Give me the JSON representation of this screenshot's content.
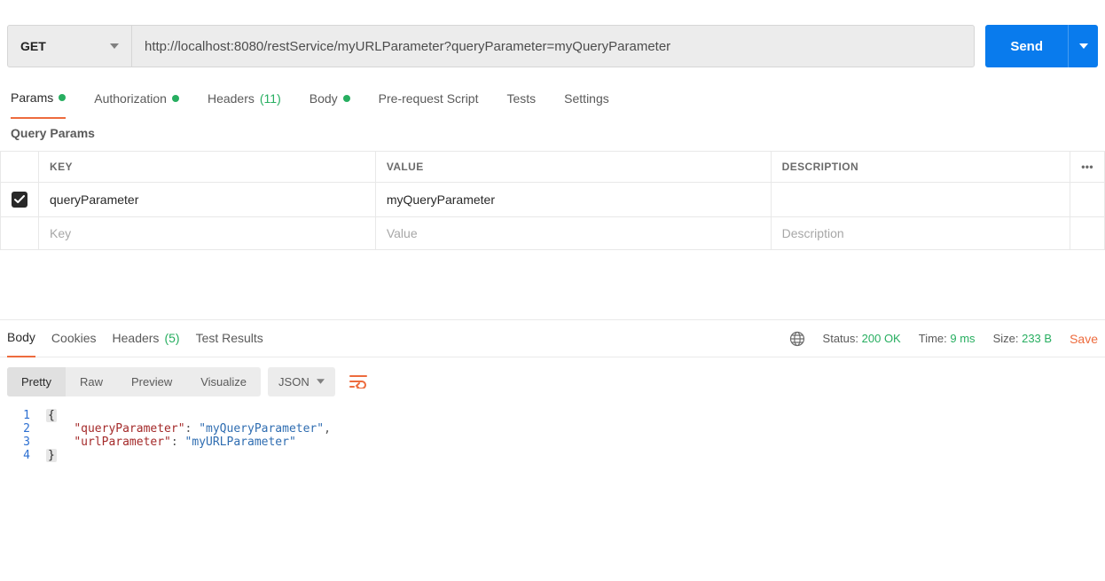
{
  "request": {
    "method": "GET",
    "url": "http://localhost:8080/restService/myURLParameter?queryParameter=myQueryParameter",
    "send_label": "Send"
  },
  "req_tabs": {
    "params": "Params",
    "authorization": "Authorization",
    "headers_label": "Headers",
    "headers_count": "(11)",
    "body": "Body",
    "prereq": "Pre-request Script",
    "tests": "Tests",
    "settings": "Settings"
  },
  "params": {
    "section_title": "Query Params",
    "col_key": "KEY",
    "col_value": "VALUE",
    "col_desc": "DESCRIPTION",
    "rows": [
      {
        "key": "queryParameter",
        "value": "myQueryParameter",
        "desc": ""
      }
    ],
    "placeholders": {
      "key": "Key",
      "value": "Value",
      "desc": "Description"
    }
  },
  "resp_tabs": {
    "body": "Body",
    "cookies": "Cookies",
    "headers_label": "Headers",
    "headers_count": "(5)",
    "test_results": "Test Results"
  },
  "resp_meta": {
    "status_label": "Status:",
    "status_value": "200 OK",
    "time_label": "Time:",
    "time_value": "9 ms",
    "size_label": "Size:",
    "size_value": "233 B",
    "save": "Save"
  },
  "view": {
    "pretty": "Pretty",
    "raw": "Raw",
    "preview": "Preview",
    "visualize": "Visualize",
    "lang": "JSON"
  },
  "body_json": {
    "queryParameter": "myQueryParameter",
    "urlParameter": "myURLParameter"
  },
  "code_lines": {
    "l1": "{",
    "l2_k": "\"queryParameter\"",
    "l2_v": "\"myQueryParameter\"",
    "l3_k": "\"urlParameter\"",
    "l3_v": "\"myURLParameter\"",
    "l4": "}",
    "n1": "1",
    "n2": "2",
    "n3": "3",
    "n4": "4"
  }
}
